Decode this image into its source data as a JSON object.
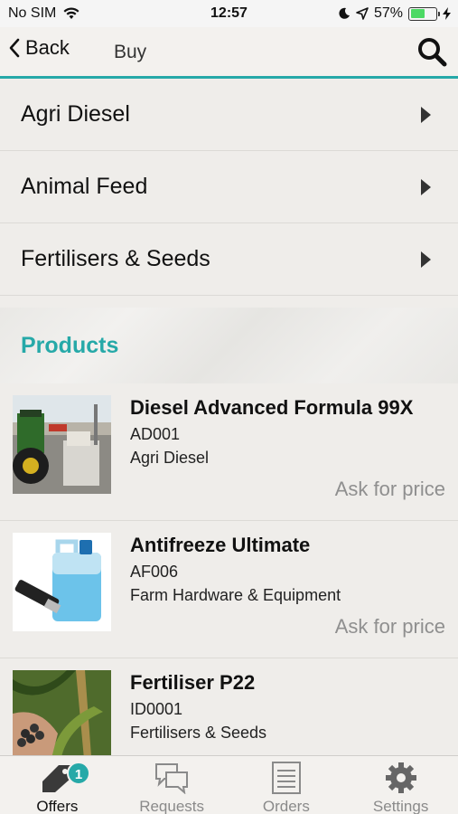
{
  "status_bar": {
    "carrier": "No SIM",
    "time": "12:57",
    "battery": "57%",
    "battery_level": 0.57,
    "icons": [
      "wifi-icon",
      "moon-icon",
      "location-icon",
      "battery-icon",
      "charging-icon"
    ]
  },
  "nav": {
    "back_label": "Back",
    "title": "Buy",
    "icons": [
      "chevron-left-icon",
      "search-icon"
    ]
  },
  "categories": [
    {
      "label": "Agri Diesel"
    },
    {
      "label": "Animal Feed"
    },
    {
      "label": "Fertilisers & Seeds"
    }
  ],
  "products_header": "Products",
  "products": [
    {
      "name": "Diesel Advanced Formula 99X",
      "code": "AD001",
      "category": "Agri Diesel",
      "price": "Ask for price"
    },
    {
      "name": "Antifreeze Ultimate",
      "code": "AF006",
      "category": "Farm Hardware & Equipment",
      "price": "Ask for price"
    },
    {
      "name": "Fertiliser P22",
      "code": "ID0001",
      "category": "Fertilisers & Seeds",
      "price": ""
    }
  ],
  "tabs": [
    {
      "label": "Offers",
      "icon": "tag-icon",
      "badge": "1",
      "active": true
    },
    {
      "label": "Requests",
      "icon": "chat-bubbles-icon",
      "active": false
    },
    {
      "label": "Orders",
      "icon": "list-icon",
      "active": false
    },
    {
      "label": "Settings",
      "icon": "gear-icon",
      "active": false
    }
  ],
  "colors": {
    "accent": "#26a9a8",
    "background": "#efedea",
    "price_text": "#8f8f8f"
  }
}
